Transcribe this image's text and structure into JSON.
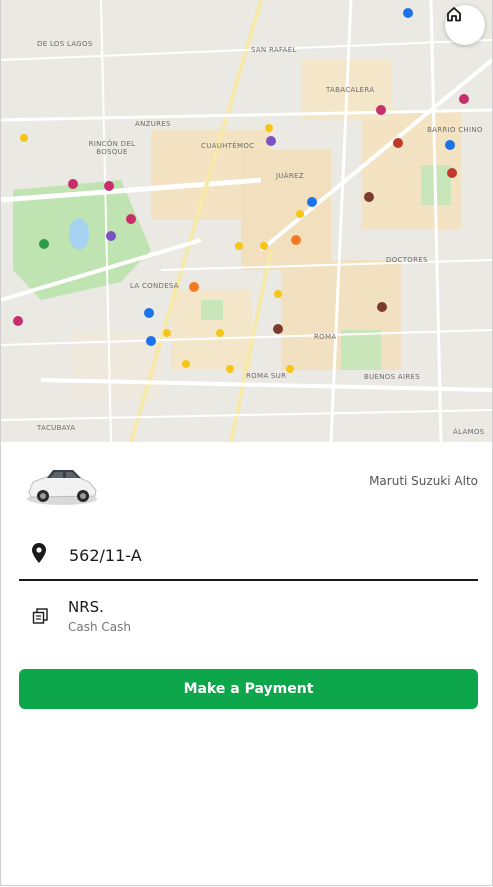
{
  "map": {
    "labels": {
      "los_lagos": "DE LOS LAGOS",
      "san_rafael": "SAN RAFAEL",
      "tabacalera": "TABACALERA",
      "rincon": "RINCÓN DEL BOSQUE",
      "cuauhtemoc": "CUAUHTÉMOC",
      "juarez": "JUÁREZ",
      "barrio_chino": "BARRIO CHINO",
      "la_condesa": "LA CONDESA",
      "doctores": "DOCTORES",
      "roma_sur": "ROMA SUR",
      "buenos_aires": "BUENOS AIRES",
      "tacubaya": "TACUBAYA",
      "alamos": "ÁLAMOS",
      "roma": "ROMA",
      "anzures": "ANZURES"
    },
    "home_icon": "home-icon",
    "colors": {
      "block": "#f3e3c3",
      "road": "#ffffff",
      "park": "#bfe3b1",
      "water": "#a7d3f0"
    }
  },
  "ride": {
    "car_model": "Maruti Suzuki Alto",
    "car_icon": "car-icon"
  },
  "location": {
    "pin_icon": "location-pin-icon",
    "value": "562/11-A"
  },
  "payment": {
    "icon": "cash-icon",
    "currency": "NRS.",
    "method": "Cash Cash",
    "button_label": "Make a Payment",
    "button_color": "#0da64a"
  }
}
